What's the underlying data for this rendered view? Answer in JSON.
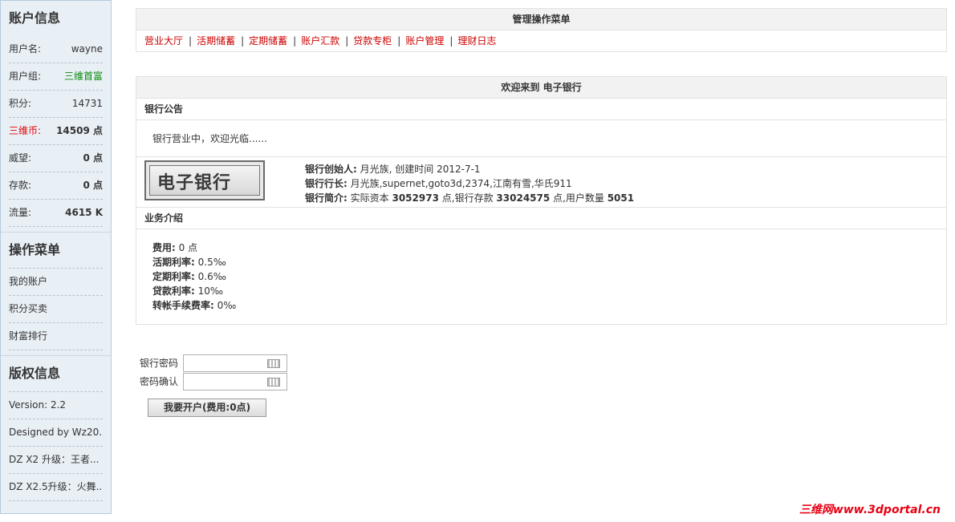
{
  "sidebar": {
    "account_title": "账户信息",
    "account_rows": [
      {
        "label": "用户名:",
        "value": "wayne"
      },
      {
        "label": "用户组:",
        "value": "三维首富"
      },
      {
        "label": "积分:",
        "value": "14731"
      },
      {
        "label": "三维币:",
        "value": "14509 点"
      },
      {
        "label": "威望:",
        "value": "0 点"
      },
      {
        "label": "存款:",
        "value": "0 点"
      },
      {
        "label": "流量:",
        "value": "4615 K"
      }
    ],
    "menu_title": "操作菜单",
    "menu_items": [
      "我的账户",
      "积分买卖",
      "财富排行"
    ],
    "copyright_title": "版权信息",
    "copyright_items": [
      "Version: 2.2",
      "Designed by Wz20...",
      "DZ X2 升级：王者...",
      "DZ X2.5升级：火舞..."
    ]
  },
  "menu_box": {
    "title": "管理操作菜单",
    "items": [
      "营业大厅",
      "活期储蓄",
      "定期储蓄",
      "账户汇款",
      "贷款专柜",
      "账户管理",
      "理财日志"
    ],
    "separator": "|"
  },
  "welcome_box": {
    "title": "欢迎来到 电子银行",
    "notice_title": "银行公告",
    "notice_text": "银行营业中，欢迎光临......",
    "logo_text": "电子银行",
    "founder_label": "银行创始人:",
    "founder_value": "月光族, 创建时间 2012-7-1",
    "president_label": "银行行长:",
    "president_value": "月光族,supernet,goto3d,2374,江南有雪,华氏911",
    "intro_label": "银行简介:",
    "intro_pre": "实际资本",
    "intro_capital": "3052973",
    "intro_mid": "点,银行存款",
    "intro_deposit": "33024575",
    "intro_mid2": "点,用户数量",
    "intro_users": "5051",
    "biz_title": "业务介绍",
    "biz_items": [
      {
        "label": "费用:",
        "value": "0 点"
      },
      {
        "label": "活期利率:",
        "value": "0.5‰"
      },
      {
        "label": "定期利率:",
        "value": "0.6‰"
      },
      {
        "label": "贷款利率:",
        "value": "10‰"
      },
      {
        "label": "转帐手续费率:",
        "value": "0‰"
      }
    ]
  },
  "form": {
    "password_label": "银行密码",
    "confirm_label": "密码确认",
    "submit_label": "我要开户(费用:0点)"
  },
  "watermark": "三维网www.3dportal.cn",
  "colors": {
    "link_red": "#cc0000",
    "green": "#0a8a0a",
    "red": "#e60000",
    "sidebar_bg": "#e8eff5"
  }
}
